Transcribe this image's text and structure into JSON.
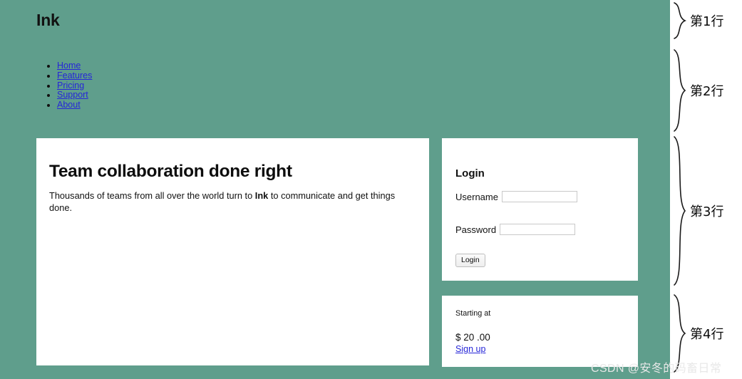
{
  "page": {
    "background_color": "#5f9e8c",
    "card_background": "#ffffff",
    "link_color": "#2626d8",
    "text_color": "#111111"
  },
  "brand": {
    "title": "Ink"
  },
  "nav": {
    "items": [
      {
        "label": "Home"
      },
      {
        "label": "Features"
      },
      {
        "label": "Pricing"
      },
      {
        "label": "Support"
      },
      {
        "label": "About"
      }
    ]
  },
  "hero": {
    "heading": "Team collaboration done right",
    "paragraph_before": "Thousands of teams from all over the world turn to ",
    "paragraph_brand": "Ink",
    "paragraph_after": " to communicate and get things done."
  },
  "login": {
    "heading": "Login",
    "username_label": "Username",
    "username_value": "",
    "username_placeholder": "",
    "password_label": "Password",
    "password_value": "",
    "password_placeholder": "",
    "submit_label": "Login"
  },
  "pricing": {
    "label": "Starting at",
    "amount": "$ 20 .00",
    "signup_label": "Sign up"
  },
  "annotations": [
    {
      "label": "第1行"
    },
    {
      "label": "第2行"
    },
    {
      "label": "第3行"
    },
    {
      "label": "第4行"
    }
  ],
  "watermark": {
    "text": "CSDN @安冬的码畜日常"
  }
}
